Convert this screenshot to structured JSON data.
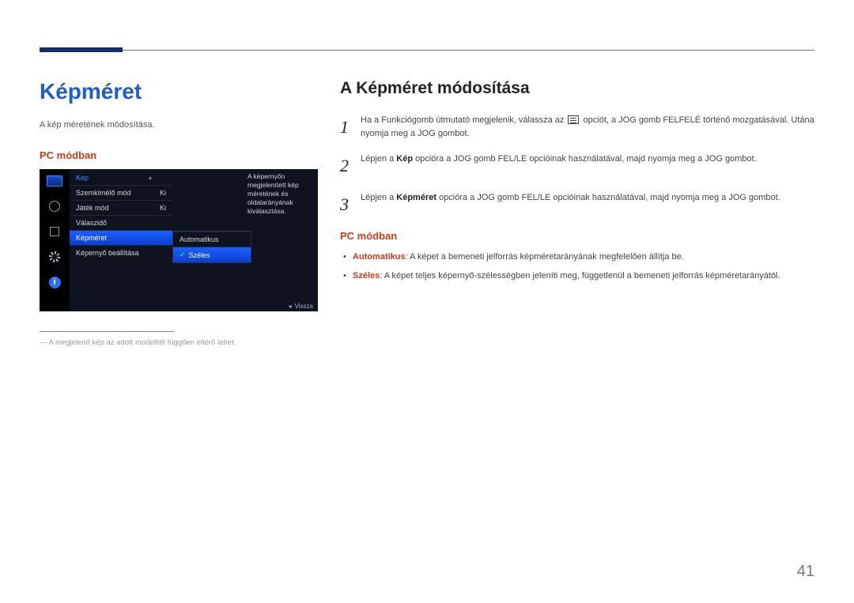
{
  "page": {
    "number": "41"
  },
  "left": {
    "title": "Képméret",
    "description": "A kép méretének módosítása.",
    "mode_label": "PC módban",
    "footnote": "― A megjelenő kép az adott modelltől függően eltérő lehet."
  },
  "osd": {
    "menu_title": "Kép",
    "items": [
      {
        "label": "Szemkímélő mód",
        "value": "Ki"
      },
      {
        "label": "Játék mód",
        "value": "Ki"
      },
      {
        "label": "Válaszidő",
        "value": ""
      },
      {
        "label": "Képméret",
        "value": ""
      },
      {
        "label": "Képernyő beállítása",
        "value": ""
      }
    ],
    "dropdown": [
      {
        "label": "Automatikus",
        "selected": false
      },
      {
        "label": "Széles",
        "selected": true
      }
    ],
    "desc": "A képernyőn megjelenített kép méretének és oldalarányának kiválasztása.",
    "back_label": "Vissza"
  },
  "right": {
    "heading": "A Képméret módosítása",
    "steps": [
      {
        "num": "1",
        "text_before": "Ha a Funkciógomb útmutató megjelenik, válassza az ",
        "text_after": " opciót, a JOG gomb FELFELÉ történő mozgatásával. Utána nyomja meg a JOG gombot."
      },
      {
        "num": "2",
        "text_before": "Lépjen a ",
        "kw": "Kép",
        "text_after": " opcióra a JOG gomb FEL/LE opcióinak használatával, majd nyomja meg a JOG gombot."
      },
      {
        "num": "3",
        "text_before": "Lépjen a ",
        "kw": "Képméret",
        "text_after": " opcióra a JOG gomb FEL/LE opcióinak használatával, majd nyomja meg a JOG gombot."
      }
    ],
    "mode_label": "PC módban",
    "bullets": [
      {
        "label": "Automatikus",
        "text": ": A képet a bemeneti jelforrás képméretarányának megfelelően állítja be."
      },
      {
        "label": "Széles",
        "text": ": A képet teljes képernyő-szélességben jeleníti meg, függetlenül a bemeneti jelforrás képméretarányától."
      }
    ]
  }
}
